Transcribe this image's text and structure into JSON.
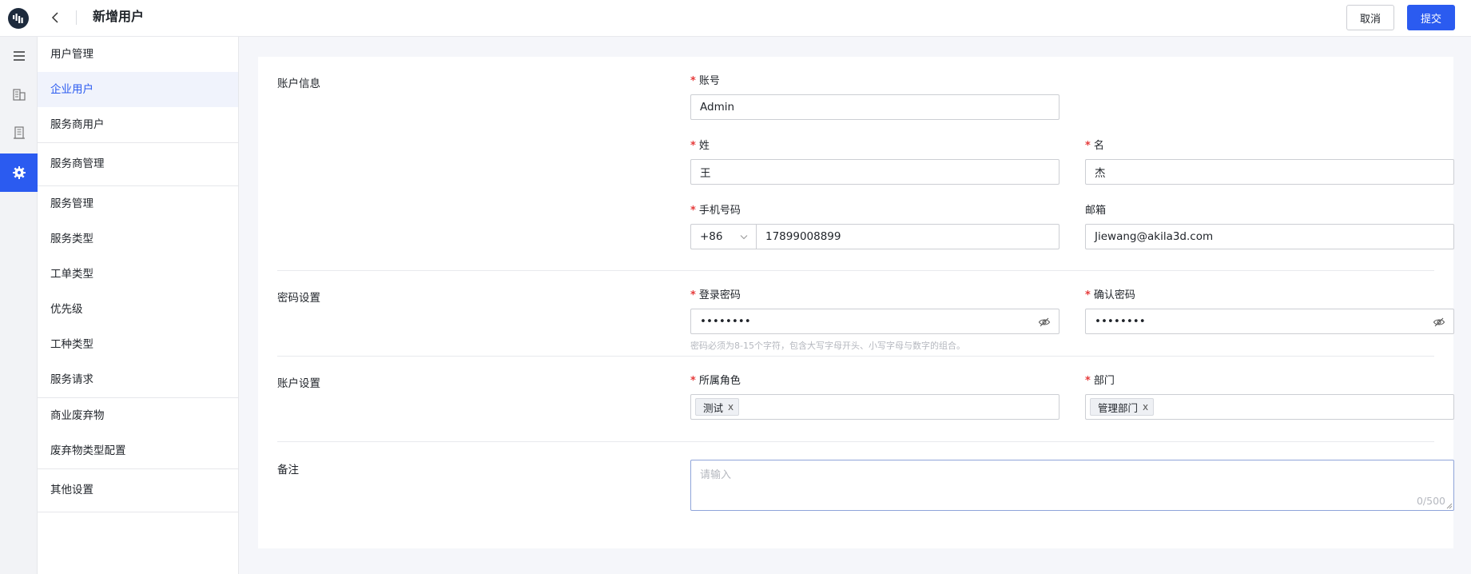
{
  "header": {
    "title": "新增用户",
    "cancel_label": "取消",
    "submit_label": "提交"
  },
  "icons": {
    "logo": "app-logo-icon",
    "back": "chevron-left-icon",
    "menu": "hamburger-menu-icon",
    "building1": "building-icon",
    "building2": "office-icon",
    "settings": "gear-icon",
    "eye": "eye-off-icon",
    "chevron": "chevron-down-icon",
    "close": "close-icon"
  },
  "colors": {
    "primary": "#2b5bf0",
    "required": "#e63b3b",
    "logo_bg": "#1d2a3c"
  },
  "sidebar": {
    "groups": [
      {
        "heading": "用户管理",
        "items": [
          "企业用户",
          "服务商用户"
        ]
      },
      {
        "heading": "服务商管理",
        "items": []
      },
      {
        "heading": "服务管理",
        "items": [
          "服务类型",
          "工单类型",
          "优先级",
          "工种类型",
          "服务请求"
        ]
      },
      {
        "heading": "商业废弃物",
        "items": [
          "废弃物类型配置"
        ]
      },
      {
        "heading": "其他设置",
        "items": []
      }
    ],
    "active": "企业用户"
  },
  "form": {
    "account_info": {
      "title": "账户信息",
      "account_label": "账号",
      "account_value": "Admin",
      "surname_label": "姓",
      "surname_value": "王",
      "given_label": "名",
      "given_value": "杰",
      "phone_label": "手机号码",
      "phone_code": "+86",
      "phone_value": "17899008899",
      "email_label": "邮箱",
      "email_value": "Jiewang@akila3d.com"
    },
    "password": {
      "title": "密码设置",
      "login_label": "登录密码",
      "login_value": "••••••••",
      "confirm_label": "确认密码",
      "confirm_value": "••••••••",
      "hint": "密码必须为8-15个字符，包含大写字母开头、小写字母与数字的组合。"
    },
    "account_settings": {
      "title": "账户设置",
      "role_label": "所属角色",
      "role_tag": "测试",
      "dept_label": "部门",
      "dept_tag": "管理部门",
      "tag_close": "x"
    },
    "remarks": {
      "title": "备注",
      "placeholder": "请输入",
      "counter": "0/500"
    }
  }
}
